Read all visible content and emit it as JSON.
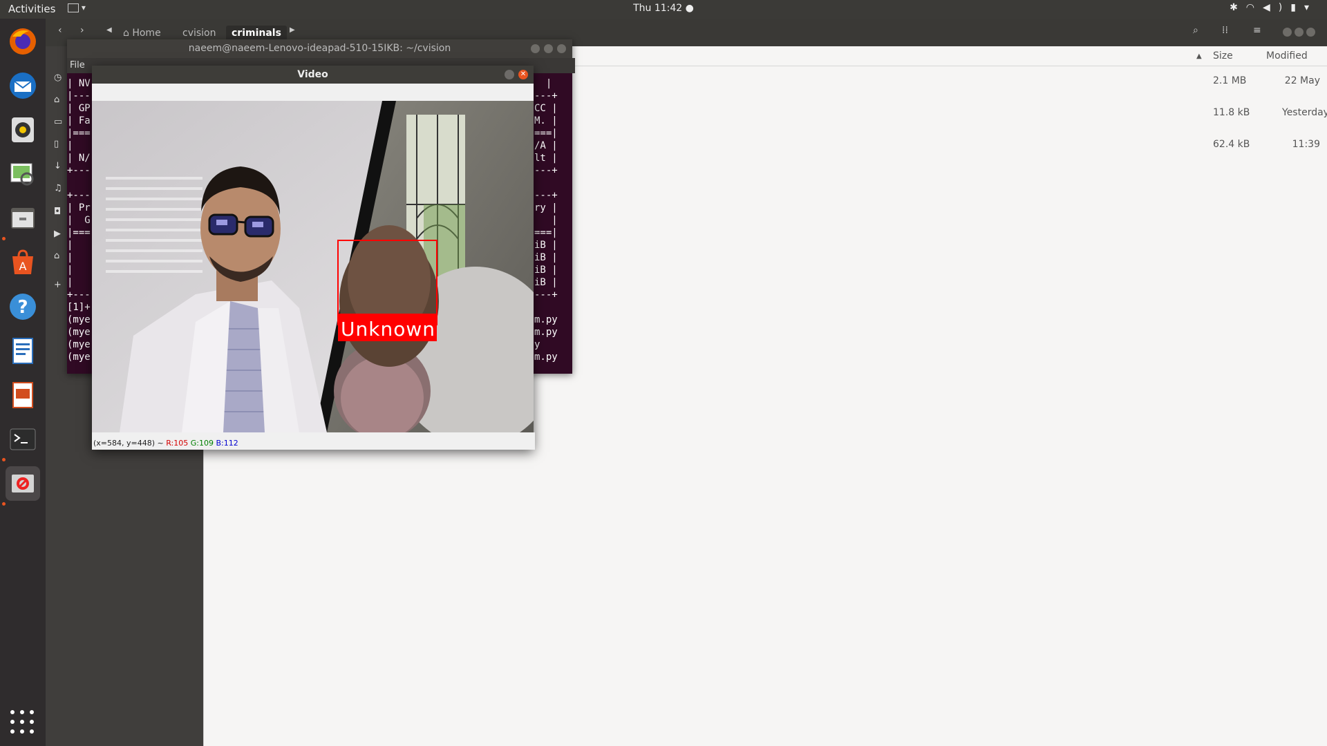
{
  "topbar": {
    "activities": "Activities",
    "clock": "Thu 11:42",
    "appmenu_arrow": "▾",
    "tray_icons": [
      "bluetooth-icon",
      "wifi-icon",
      "volume-icon",
      "battery-icon",
      "system-menu-icon"
    ]
  },
  "dock": {
    "items": [
      "firefox-icon",
      "thunderbird-icon",
      "rhythmbox-icon",
      "image-viewer-icon",
      "files-icon",
      "software-center-icon",
      "help-icon",
      "writer-icon",
      "impress-icon",
      "terminal-icon",
      "video-app-icon"
    ],
    "apps_grid": "show-applications-icon"
  },
  "files": {
    "breadcrumbs": [
      "Home",
      "cvision",
      "criminals"
    ],
    "columns": {
      "size": "Size",
      "modified": "Modified"
    },
    "rows": [
      {
        "size": "2.1 MB",
        "modified": "22 May"
      },
      {
        "size": "11.8 kB",
        "modified": "Yesterday"
      },
      {
        "size": "62.4 kB",
        "modified": "11:39"
      }
    ]
  },
  "terminal": {
    "title": "naeem@naeem-Lenovo-ideapad-510-15IKB: ~/cvision",
    "menu": "File",
    "lines_left": [
      "| NV",
      "|---",
      "| GP",
      "| Fa",
      "|===",
      "|   ",
      "| N/",
      "+---",
      "",
      "+---",
      "| Pr",
      "|  G",
      "|===",
      "|   ",
      "|   ",
      "|   ",
      "|   ",
      "+---",
      "[1]+",
      "(mye",
      "(mye",
      "(mye",
      "(mye"
    ],
    "lines_right": [
      "  |",
      "---+",
      "CC |",
      "M. |",
      "===|",
      "/A |",
      "lt |",
      "---+",
      "",
      "---+",
      "ry |",
      "   |",
      "===|",
      "iB |",
      "iB |",
      "iB |",
      "iB |",
      "---+",
      "",
      "m.py",
      "m.py",
      "y",
      "m.py"
    ]
  },
  "video": {
    "title": "Video",
    "label": "Unknown",
    "status_pos": "(x=584, y=448) ~",
    "status_r": "R:105",
    "status_g": "G:109",
    "status_b": "B:112"
  }
}
